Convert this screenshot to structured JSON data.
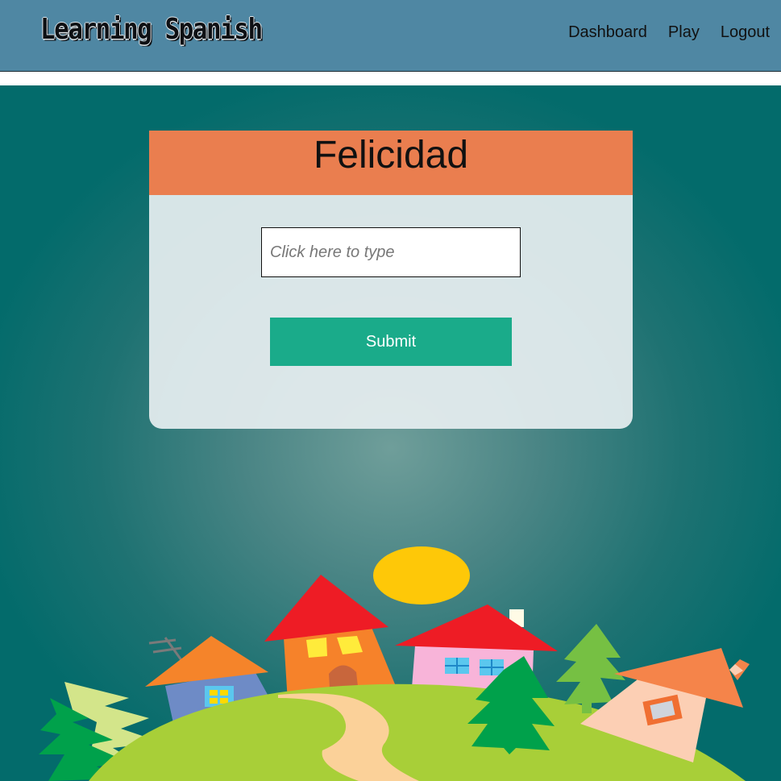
{
  "navbar": {
    "logo_text": "Learning Spanish",
    "links": [
      {
        "label": "Dashboard"
      },
      {
        "label": "Play"
      },
      {
        "label": "Logout"
      }
    ]
  },
  "card": {
    "word": "Felicidad",
    "input_placeholder": "Click here to type",
    "input_value": "",
    "submit_label": "Submit"
  },
  "colors": {
    "navbar": "#4f87a3",
    "card_header": "#ea7e4f",
    "submit": "#1aab8a",
    "background": "#036b6b"
  },
  "illustration": {
    "icons": [
      "sun-icon",
      "house-icon",
      "tree-icon",
      "hill-icon",
      "path-icon"
    ]
  }
}
